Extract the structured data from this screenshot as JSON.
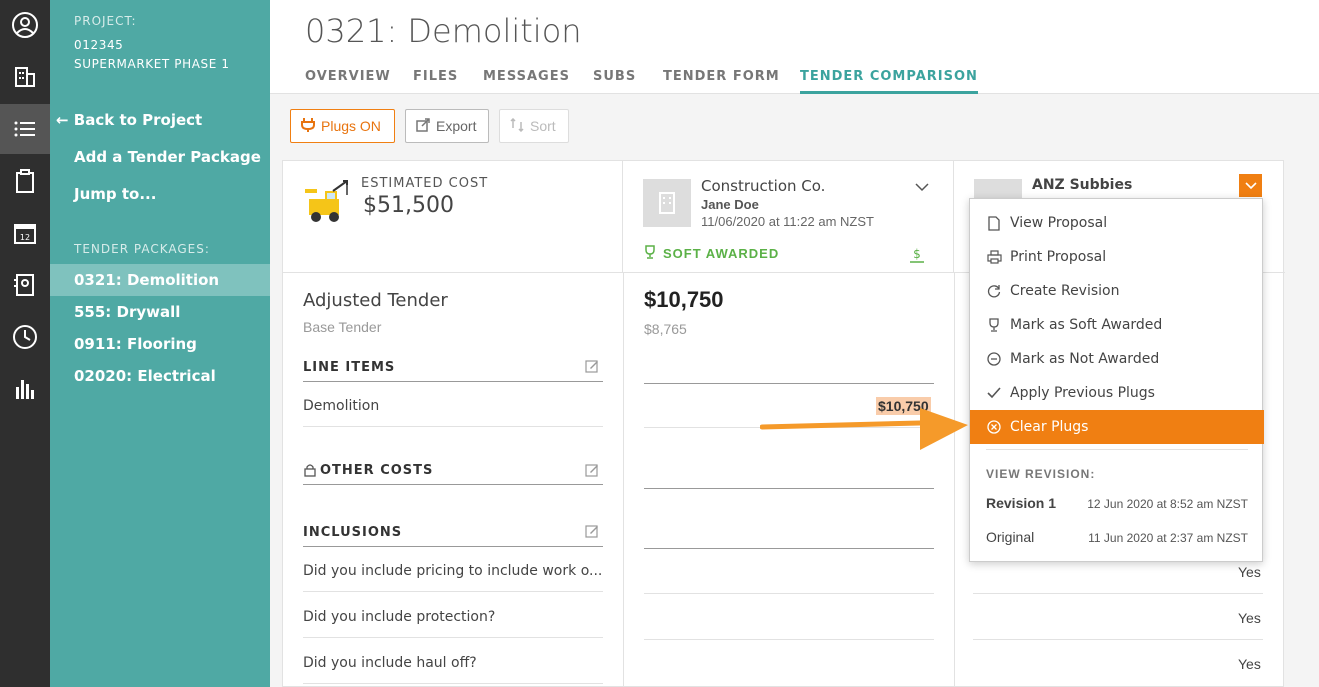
{
  "rail": {
    "items": [
      "account-icon",
      "buildings-icon",
      "list-icon",
      "clipboard-icon",
      "calendar-icon",
      "contacts-icon",
      "clock-icon",
      "reports-icon"
    ],
    "calendar_day": "12"
  },
  "sidebar": {
    "project_label": "PROJECT:",
    "project_code": "012345",
    "project_name": "SUPERMARKET PHASE 1",
    "back_link": "Back to Project",
    "add_package": "Add a Tender Package",
    "jump_to": "Jump to...",
    "packages_label": "TENDER PACKAGES:",
    "packages": [
      "0321: Demolition",
      "555: Drywall",
      "0911: Flooring",
      "02020: Electrical"
    ]
  },
  "header": {
    "title": "0321: Demolition",
    "tabs": [
      "OVERVIEW",
      "FILES",
      "MESSAGES",
      "SUBS",
      "TENDER FORM",
      "TENDER COMPARISON"
    ],
    "active_tab": "TENDER COMPARISON"
  },
  "toolbar": {
    "plugs_label": "Plugs ON",
    "export_label": "Export",
    "sort_label": "Sort"
  },
  "estimate": {
    "label": "ESTIMATED COST",
    "value": "$51,500"
  },
  "labels": {
    "adjusted_tender": "Adjusted Tender",
    "base_tender": "Base Tender",
    "line_items": "LINE ITEMS",
    "demolition": "Demolition",
    "other_costs": "OTHER COSTS",
    "inclusions": "INCLUSIONS",
    "questions": [
      "Did you include pricing to include work o...",
      "Did you include protection?",
      "Did you include haul off?"
    ]
  },
  "subs": [
    {
      "name": "Construction Co.",
      "contact": "Jane Doe",
      "date": "11/06/2020 at 11:22 am NZST",
      "status": "SOFT AWARDED",
      "adjusted": "$10,750",
      "base": "$8,765",
      "demolition": "$10,750"
    },
    {
      "name": "ANZ Subbies",
      "answers": [
        "Yes",
        "Yes",
        "Yes"
      ]
    }
  ],
  "dropdown": {
    "items": [
      "View Proposal",
      "Print Proposal",
      "Create Revision",
      "Mark as Soft Awarded",
      "Mark as Not Awarded",
      "Apply Previous Plugs",
      "Clear Plugs"
    ],
    "revision_label": "VIEW REVISION:",
    "revisions": [
      {
        "name": "Revision 1",
        "date": "12 Jun 2020 at 8:52 am NZST"
      },
      {
        "name": "Original",
        "date": "11 Jun 2020 at 2:37 am NZST"
      }
    ]
  },
  "colors": {
    "accent": "#f07f12",
    "teal": "#4fa9a4",
    "green": "#5bb147"
  }
}
